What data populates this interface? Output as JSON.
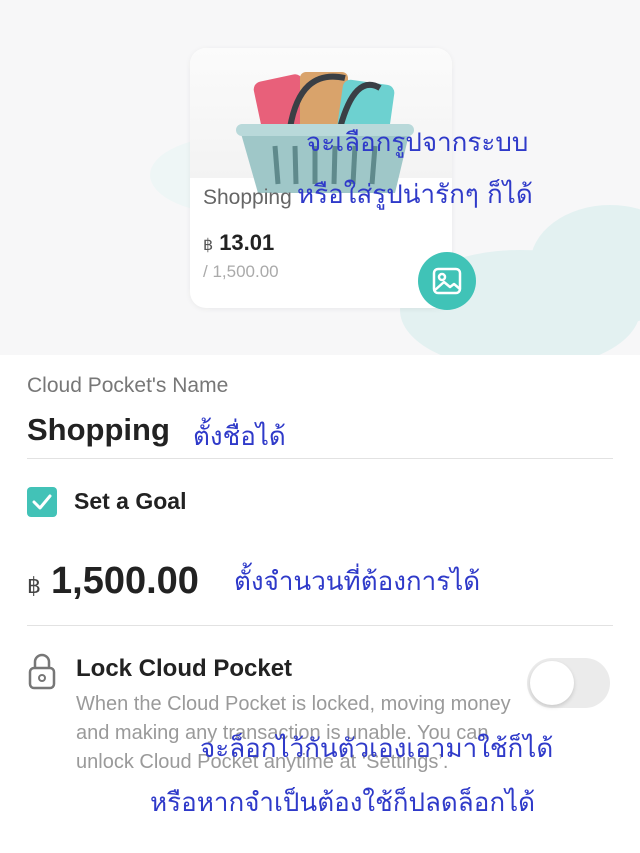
{
  "card": {
    "name": "Shopping",
    "currency": "฿",
    "amount": "13.01",
    "goal": "/ 1,500.00",
    "progress": 0.0087
  },
  "annotations": {
    "image_line1": "จะเลือกรูปจากระบบ",
    "image_line2": "หรือใส่รูปน่ารักๆ ก็ได้",
    "name": "ตั้งชื่อได้",
    "goal": "ตั้งจำนวนที่ต้องการได้",
    "lock_line1": "จะล็อกไว้กันตัวเองเอามาใช้ก็ได้",
    "lock_line2": "หรือหากจำเป็นต้องใช้ก็ปลดล็อกได้"
  },
  "form": {
    "name_label": "Cloud Pocket's Name",
    "name_value": "Shopping",
    "goal_label": "Set a Goal",
    "goal_checked": true,
    "goal_currency": "฿",
    "goal_value": "1,500.00",
    "lock_title": "Lock Cloud Pocket",
    "lock_description": "When the Cloud Pocket is locked, moving money and making any transaction is unable. You can unlock Cloud Pocket anytime at ‘Settings’.",
    "lock_enabled": false
  },
  "icons": {
    "image_button": "image-icon",
    "checkbox": "check-icon",
    "lock": "lock-icon"
  },
  "colors": {
    "accent": "#42c2b7",
    "annotation": "#2f3ac9"
  }
}
